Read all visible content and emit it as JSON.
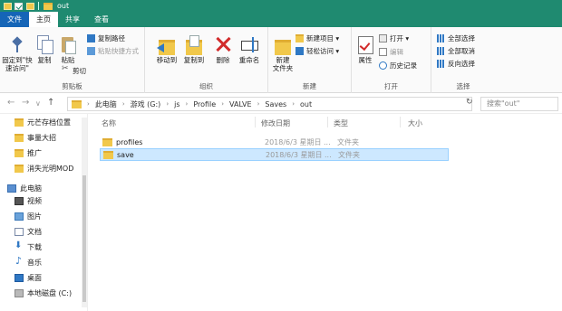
{
  "window": {
    "title": "out"
  },
  "tabs": [
    "文件",
    "主页",
    "共享",
    "查看"
  ],
  "ribbon": {
    "clipboard": {
      "pin_label_1": "固定到\"快",
      "pin_label_2": "速访问\"",
      "copy_label": "复制",
      "paste_label": "粘贴",
      "copy_path": "复制路径",
      "paste_shortcut": "粘贴快捷方式",
      "cut": "剪切",
      "group_label": "剪贴板"
    },
    "organize": {
      "move_to": "移动到",
      "copy_to": "复制到",
      "delete": "删除",
      "rename": "重命名",
      "group_label": "组织"
    },
    "new": {
      "new_folder_1": "新建",
      "new_folder_2": "文件夹",
      "new_item": "新建项目 ▾",
      "easy_access": "轻松访问 ▾",
      "group_label": "新建"
    },
    "open": {
      "properties": "属性",
      "open": "打开 ▾",
      "edit": "编辑",
      "history": "历史记录",
      "group_label": "打开"
    },
    "select": {
      "select_all": "全部选择",
      "select_none": "全部取消",
      "invert": "反向选择",
      "group_label": "选择"
    }
  },
  "nav": {
    "back": "←",
    "forward": "→",
    "recent": "∨",
    "up": "↑",
    "breadcrumbs": [
      "此电脑",
      "游戏 (G:)",
      "js",
      "Profile",
      "VALVE",
      "Saves",
      "out"
    ],
    "crumb_arrow": "›",
    "refresh": "↻",
    "search_placeholder": "搜索\"out\""
  },
  "sidebar": {
    "items": [
      {
        "label": "元芒存档位置",
        "icon": "folder"
      },
      {
        "label": "事量大招",
        "icon": "folder"
      },
      {
        "label": "推广",
        "icon": "folder"
      },
      {
        "label": "消失光明MOD",
        "icon": "folder"
      },
      {
        "label": "此电脑",
        "icon": "pc"
      },
      {
        "label": "视频",
        "icon": "video"
      },
      {
        "label": "图片",
        "icon": "pictures"
      },
      {
        "label": "文档",
        "icon": "documents"
      },
      {
        "label": "下载",
        "icon": "downloads"
      },
      {
        "label": "音乐",
        "icon": "music"
      },
      {
        "label": "桌面",
        "icon": "desktop"
      },
      {
        "label": "本地磁盘 (C:)",
        "icon": "drive"
      }
    ]
  },
  "columns": {
    "name": "名称",
    "date": "修改日期",
    "type": "类型",
    "size": "大小"
  },
  "files": [
    {
      "name": "profiles",
      "date": "2018/6/3 星期日 ...",
      "type": "文件夹"
    },
    {
      "name": "save",
      "date": "2018/6/3 星期日 ...",
      "type": "文件夹",
      "selected": true
    }
  ]
}
